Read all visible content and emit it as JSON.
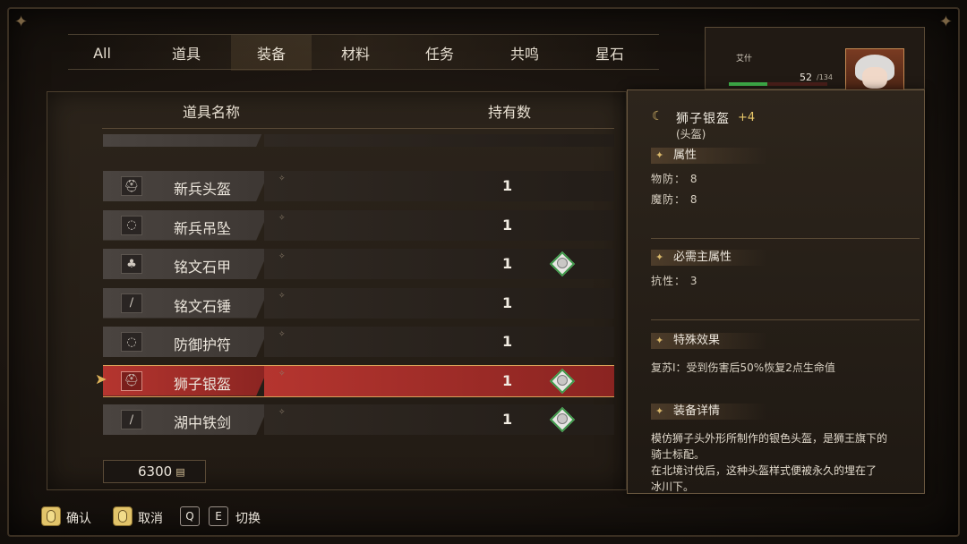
{
  "tabs": [
    "All",
    "道具",
    "装备",
    "材料",
    "任务",
    "共鸣",
    "星石"
  ],
  "active_tab": 2,
  "list": {
    "header_name": "道具名称",
    "header_count": "持有数",
    "rows": [
      {
        "name": "新兵头盔",
        "count": "1",
        "icon": "helmet-icon",
        "glyph": "⛑",
        "equipped": false
      },
      {
        "name": "新兵吊坠",
        "count": "1",
        "icon": "pendant-icon",
        "glyph": "◌",
        "equipped": false
      },
      {
        "name": "铭文石甲",
        "count": "1",
        "icon": "armor-icon",
        "glyph": "♣",
        "equipped": true
      },
      {
        "name": "铭文石锤",
        "count": "1",
        "icon": "hammer-icon",
        "glyph": "∕",
        "equipped": false
      },
      {
        "name": "防御护符",
        "count": "1",
        "icon": "amulet-icon",
        "glyph": "◌",
        "equipped": false
      },
      {
        "name": "狮子银盔",
        "count": "1",
        "icon": "helmet-icon",
        "glyph": "⛑",
        "equipped": true,
        "selected": true
      },
      {
        "name": "湖中铁剑",
        "count": "1",
        "icon": "sword-icon",
        "glyph": "∕",
        "equipped": true
      }
    ]
  },
  "gold": "6300",
  "character": {
    "name": "艾什",
    "hp_current": "52",
    "hp_max": "/134",
    "hp_fraction": 0.39
  },
  "detail": {
    "title": "狮子银盔",
    "plus": "+4",
    "category": "(头盔)",
    "sections": {
      "attributes": "属性",
      "requirements": "必需主属性",
      "special": "特殊效果",
      "details": "装备详情"
    },
    "phys_def": "物防： 8",
    "mag_def": "魔防： 8",
    "req_resist": "抗性： 3",
    "effect": "复苏Ⅰ：受到伤害后50%恢复2点生命值",
    "desc_lines": [
      "模仿狮子头外形所制作的银色头盔，是狮王旗下的",
      "骑士标配。",
      "在北境讨伐后，这种头盔样式便被永久的埋在了",
      "冰川下。"
    ]
  },
  "controls": {
    "confirm": "确认",
    "cancel": "取消",
    "key_q": "Q",
    "key_e": "E",
    "switch": "切换"
  },
  "colors": {
    "selected_row": "#b5352f",
    "accent_gold": "#d8b76a",
    "hp_green": "#3fb04a"
  }
}
